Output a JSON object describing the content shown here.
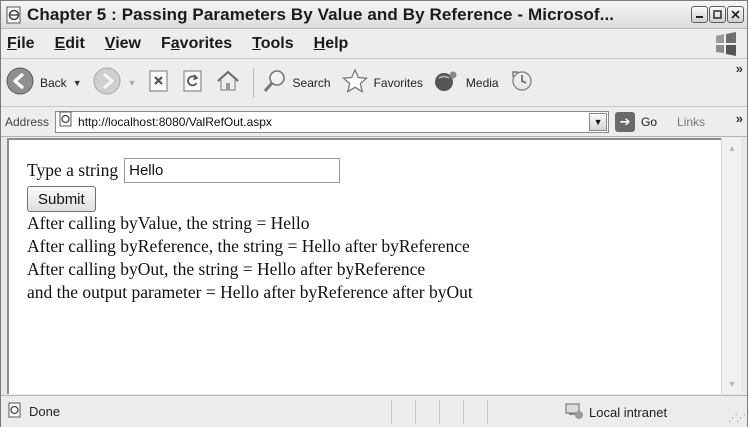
{
  "window": {
    "title": "Chapter 5 : Passing Parameters By Value and By Reference - Microsof...",
    "controls": [
      "minimize",
      "maximize",
      "close"
    ]
  },
  "menu": {
    "items": [
      {
        "label": "File",
        "accel": "F"
      },
      {
        "label": "Edit",
        "accel": "E"
      },
      {
        "label": "View",
        "accel": "V"
      },
      {
        "label": "Favorites",
        "accel": "a"
      },
      {
        "label": "Tools",
        "accel": "T"
      },
      {
        "label": "Help",
        "accel": "H"
      }
    ]
  },
  "toolbar": {
    "back_label": "Back",
    "search_label": "Search",
    "favorites_label": "Favorites",
    "media_label": "Media",
    "overflow": "»"
  },
  "address": {
    "label": "Address",
    "url": "http://localhost:8080/ValRefOut.aspx",
    "go_label": "Go",
    "links_label": "Links",
    "overflow": "»"
  },
  "page": {
    "prompt_label": "Type a string",
    "input_value": "Hello",
    "submit_label": "Submit",
    "output_lines": [
      "After calling byValue, the string = Hello",
      "After calling byReference, the string = Hello after byReference",
      "After calling byOut, the string = Hello after byReference",
      "and the output parameter = Hello after byReference after byOut"
    ]
  },
  "status": {
    "text": "Done",
    "zone": "Local intranet"
  },
  "icons": {
    "app": "ie-page-icon",
    "back": "back-arrow-icon",
    "forward": "forward-arrow-icon",
    "stop": "stop-icon",
    "refresh": "refresh-icon",
    "home": "home-icon",
    "search": "search-icon",
    "favorites": "favorites-star-icon",
    "media": "media-icon",
    "history": "history-icon"
  }
}
